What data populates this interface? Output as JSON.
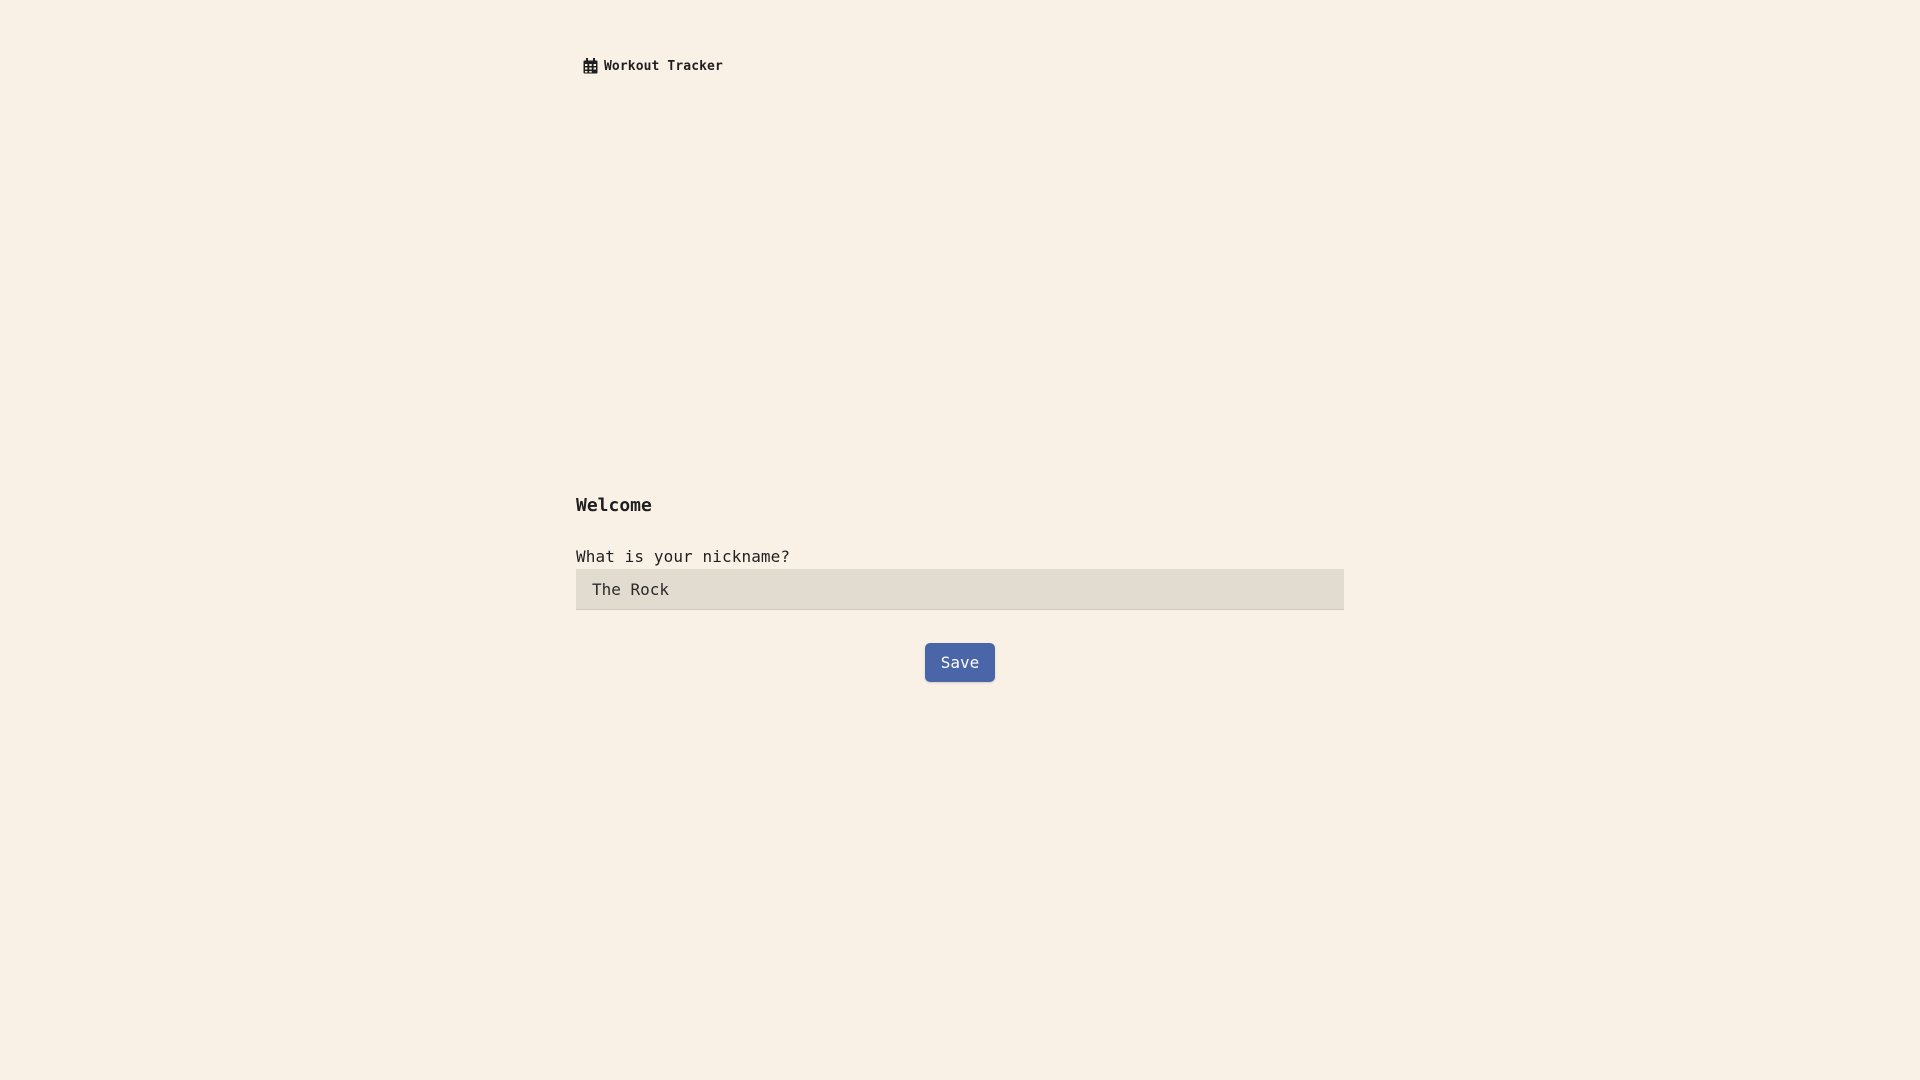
{
  "app": {
    "title": "Workout Tracker",
    "icon": "calendar-icon"
  },
  "welcome": {
    "heading": "Welcome",
    "nickname_label": "What is your nickname?",
    "nickname_value": "The Rock",
    "save_label": "Save"
  },
  "colors": {
    "background": "#f9f1e6",
    "input_background": "#e2dbd0",
    "button_accent": "#4a66a9"
  }
}
